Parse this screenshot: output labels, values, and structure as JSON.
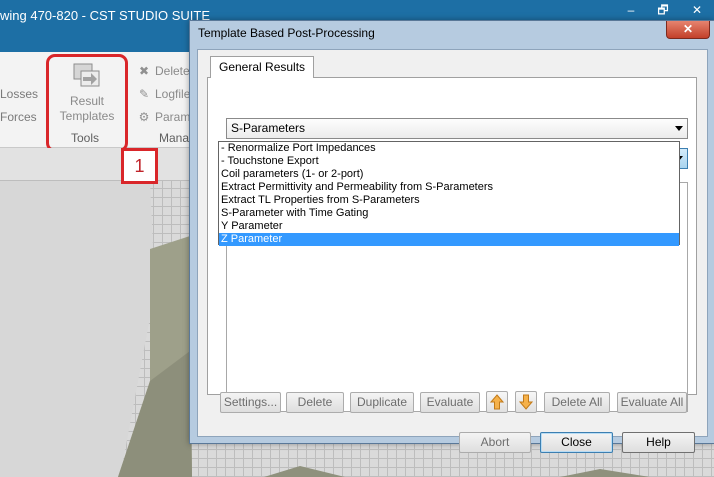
{
  "app": {
    "title": "wing 470-820 - CST STUDIO SUITE",
    "window_controls": {
      "minimize": "–",
      "restore": "🗗",
      "close": "✕"
    }
  },
  "ribbon": {
    "left_items": [
      "Losses",
      "Forces"
    ],
    "result_templates_label_1": "Result",
    "result_templates_label_2": "Templates",
    "tools_group_label": "Tools",
    "small_buttons": [
      "Delete",
      "Logfile",
      "Param"
    ],
    "manage_group_label": "Mana"
  },
  "annotation": {
    "callout_number": "1"
  },
  "dialog": {
    "title": "Template Based Post-Processing",
    "close_glyph": "✕",
    "tab_label": "General Results",
    "category_select": {
      "value": "S-Parameters"
    },
    "template_select": {
      "value": ""
    },
    "template_options": [
      "- Renormalize Port Impedances",
      "- Touchstone Export",
      "Coil parameters (1- or 2-port)",
      "Extract Permittivity and Permeability from S-Parameters",
      "Extract TL Properties from S-Parameters",
      "S-Parameter with Time Gating",
      "Y Parameter",
      "Z Parameter"
    ],
    "selected_option": "Z Parameter",
    "toolbar_buttons": {
      "settings": "Settings...",
      "delete": "Delete",
      "duplicate": "Duplicate",
      "evaluate": "Evaluate",
      "delete_all": "Delete All",
      "evaluate_all": "Evaluate All"
    },
    "footer_buttons": {
      "abort": "Abort",
      "close": "Close",
      "help": "Help"
    }
  },
  "colors": {
    "title_bar": "#1d6fa5",
    "highlight_red": "#d9262a",
    "selection_blue": "#3399ff",
    "arrow_orange": "#f0a030"
  }
}
